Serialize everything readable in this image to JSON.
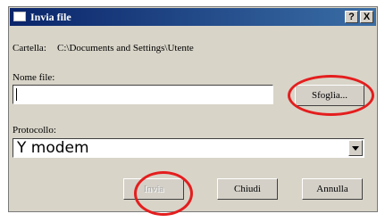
{
  "window": {
    "title": "Invia file",
    "help_label": "?",
    "close_label": "X"
  },
  "folder": {
    "label": "Cartella:",
    "path": "C:\\Documents and Settings\\Utente"
  },
  "file_name": {
    "label": "Nome file:",
    "value": ""
  },
  "buttons": {
    "browse": "Sfoglia...",
    "send": "Invia",
    "close": "Chiudi",
    "cancel": "Annulla"
  },
  "protocol": {
    "label": "Protocollo:",
    "selected": "Y modem"
  },
  "colors": {
    "annotation": "#e41e1e",
    "titlebar": "#0a246a"
  }
}
